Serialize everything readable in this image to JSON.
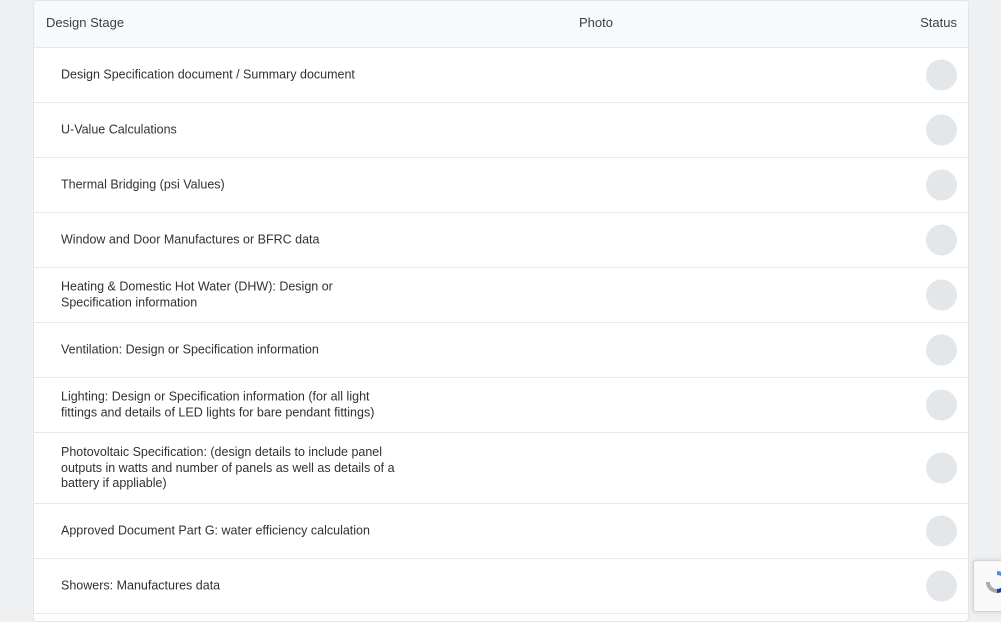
{
  "table": {
    "headers": {
      "stage": "Design Stage",
      "photo": "Photo",
      "status": "Status"
    },
    "rows": [
      {
        "label": "Design Specification document / Summary document"
      },
      {
        "label": "U-Value Calculations"
      },
      {
        "label": "Thermal Bridging (psi Values)"
      },
      {
        "label": "Window and Door Manufactures or BFRC data"
      },
      {
        "label": "Heating & Domestic Hot Water (DHW): Design or Specification information"
      },
      {
        "label": "Ventilation: Design or Specification information"
      },
      {
        "label": "Lighting: Design or Specification information (for all light fittings and details of LED lights for bare pendant fittings)"
      },
      {
        "label": "Photovoltaic Specification: (design details to include panel outputs in watts and number of panels as well as details of a battery if appliable)"
      },
      {
        "label": "Approved Document Part G: water efficiency calculation"
      },
      {
        "label": "Showers: Manufactures data"
      }
    ]
  },
  "icons": {
    "status": "status-circle-icon",
    "recaptcha": "recaptcha-icon"
  },
  "colors": {
    "background": "#eef0f2",
    "header_bg": "#f8f9fa",
    "status_dot": "#e4e7ea",
    "recaptcha_blue": "#4a90e2"
  }
}
